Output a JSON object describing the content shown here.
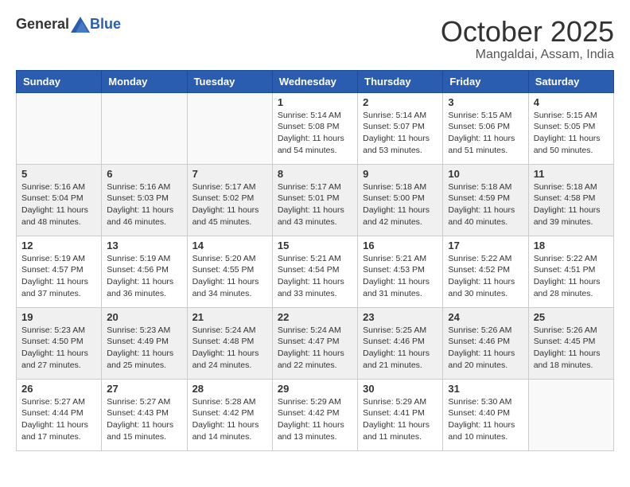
{
  "header": {
    "logo_general": "General",
    "logo_blue": "Blue",
    "month": "October 2025",
    "location": "Mangaldai, Assam, India"
  },
  "weekdays": [
    "Sunday",
    "Monday",
    "Tuesday",
    "Wednesday",
    "Thursday",
    "Friday",
    "Saturday"
  ],
  "weeks": [
    [
      {
        "day": "",
        "sunrise": "",
        "sunset": "",
        "daylight": ""
      },
      {
        "day": "",
        "sunrise": "",
        "sunset": "",
        "daylight": ""
      },
      {
        "day": "",
        "sunrise": "",
        "sunset": "",
        "daylight": ""
      },
      {
        "day": "1",
        "sunrise": "Sunrise: 5:14 AM",
        "sunset": "Sunset: 5:08 PM",
        "daylight": "Daylight: 11 hours and 54 minutes."
      },
      {
        "day": "2",
        "sunrise": "Sunrise: 5:14 AM",
        "sunset": "Sunset: 5:07 PM",
        "daylight": "Daylight: 11 hours and 53 minutes."
      },
      {
        "day": "3",
        "sunrise": "Sunrise: 5:15 AM",
        "sunset": "Sunset: 5:06 PM",
        "daylight": "Daylight: 11 hours and 51 minutes."
      },
      {
        "day": "4",
        "sunrise": "Sunrise: 5:15 AM",
        "sunset": "Sunset: 5:05 PM",
        "daylight": "Daylight: 11 hours and 50 minutes."
      }
    ],
    [
      {
        "day": "5",
        "sunrise": "Sunrise: 5:16 AM",
        "sunset": "Sunset: 5:04 PM",
        "daylight": "Daylight: 11 hours and 48 minutes."
      },
      {
        "day": "6",
        "sunrise": "Sunrise: 5:16 AM",
        "sunset": "Sunset: 5:03 PM",
        "daylight": "Daylight: 11 hours and 46 minutes."
      },
      {
        "day": "7",
        "sunrise": "Sunrise: 5:17 AM",
        "sunset": "Sunset: 5:02 PM",
        "daylight": "Daylight: 11 hours and 45 minutes."
      },
      {
        "day": "8",
        "sunrise": "Sunrise: 5:17 AM",
        "sunset": "Sunset: 5:01 PM",
        "daylight": "Daylight: 11 hours and 43 minutes."
      },
      {
        "day": "9",
        "sunrise": "Sunrise: 5:18 AM",
        "sunset": "Sunset: 5:00 PM",
        "daylight": "Daylight: 11 hours and 42 minutes."
      },
      {
        "day": "10",
        "sunrise": "Sunrise: 5:18 AM",
        "sunset": "Sunset: 4:59 PM",
        "daylight": "Daylight: 11 hours and 40 minutes."
      },
      {
        "day": "11",
        "sunrise": "Sunrise: 5:18 AM",
        "sunset": "Sunset: 4:58 PM",
        "daylight": "Daylight: 11 hours and 39 minutes."
      }
    ],
    [
      {
        "day": "12",
        "sunrise": "Sunrise: 5:19 AM",
        "sunset": "Sunset: 4:57 PM",
        "daylight": "Daylight: 11 hours and 37 minutes."
      },
      {
        "day": "13",
        "sunrise": "Sunrise: 5:19 AM",
        "sunset": "Sunset: 4:56 PM",
        "daylight": "Daylight: 11 hours and 36 minutes."
      },
      {
        "day": "14",
        "sunrise": "Sunrise: 5:20 AM",
        "sunset": "Sunset: 4:55 PM",
        "daylight": "Daylight: 11 hours and 34 minutes."
      },
      {
        "day": "15",
        "sunrise": "Sunrise: 5:21 AM",
        "sunset": "Sunset: 4:54 PM",
        "daylight": "Daylight: 11 hours and 33 minutes."
      },
      {
        "day": "16",
        "sunrise": "Sunrise: 5:21 AM",
        "sunset": "Sunset: 4:53 PM",
        "daylight": "Daylight: 11 hours and 31 minutes."
      },
      {
        "day": "17",
        "sunrise": "Sunrise: 5:22 AM",
        "sunset": "Sunset: 4:52 PM",
        "daylight": "Daylight: 11 hours and 30 minutes."
      },
      {
        "day": "18",
        "sunrise": "Sunrise: 5:22 AM",
        "sunset": "Sunset: 4:51 PM",
        "daylight": "Daylight: 11 hours and 28 minutes."
      }
    ],
    [
      {
        "day": "19",
        "sunrise": "Sunrise: 5:23 AM",
        "sunset": "Sunset: 4:50 PM",
        "daylight": "Daylight: 11 hours and 27 minutes."
      },
      {
        "day": "20",
        "sunrise": "Sunrise: 5:23 AM",
        "sunset": "Sunset: 4:49 PM",
        "daylight": "Daylight: 11 hours and 25 minutes."
      },
      {
        "day": "21",
        "sunrise": "Sunrise: 5:24 AM",
        "sunset": "Sunset: 4:48 PM",
        "daylight": "Daylight: 11 hours and 24 minutes."
      },
      {
        "day": "22",
        "sunrise": "Sunrise: 5:24 AM",
        "sunset": "Sunset: 4:47 PM",
        "daylight": "Daylight: 11 hours and 22 minutes."
      },
      {
        "day": "23",
        "sunrise": "Sunrise: 5:25 AM",
        "sunset": "Sunset: 4:46 PM",
        "daylight": "Daylight: 11 hours and 21 minutes."
      },
      {
        "day": "24",
        "sunrise": "Sunrise: 5:26 AM",
        "sunset": "Sunset: 4:46 PM",
        "daylight": "Daylight: 11 hours and 20 minutes."
      },
      {
        "day": "25",
        "sunrise": "Sunrise: 5:26 AM",
        "sunset": "Sunset: 4:45 PM",
        "daylight": "Daylight: 11 hours and 18 minutes."
      }
    ],
    [
      {
        "day": "26",
        "sunrise": "Sunrise: 5:27 AM",
        "sunset": "Sunset: 4:44 PM",
        "daylight": "Daylight: 11 hours and 17 minutes."
      },
      {
        "day": "27",
        "sunrise": "Sunrise: 5:27 AM",
        "sunset": "Sunset: 4:43 PM",
        "daylight": "Daylight: 11 hours and 15 minutes."
      },
      {
        "day": "28",
        "sunrise": "Sunrise: 5:28 AM",
        "sunset": "Sunset: 4:42 PM",
        "daylight": "Daylight: 11 hours and 14 minutes."
      },
      {
        "day": "29",
        "sunrise": "Sunrise: 5:29 AM",
        "sunset": "Sunset: 4:42 PM",
        "daylight": "Daylight: 11 hours and 13 minutes."
      },
      {
        "day": "30",
        "sunrise": "Sunrise: 5:29 AM",
        "sunset": "Sunset: 4:41 PM",
        "daylight": "Daylight: 11 hours and 11 minutes."
      },
      {
        "day": "31",
        "sunrise": "Sunrise: 5:30 AM",
        "sunset": "Sunset: 4:40 PM",
        "daylight": "Daylight: 11 hours and 10 minutes."
      },
      {
        "day": "",
        "sunrise": "",
        "sunset": "",
        "daylight": ""
      }
    ]
  ]
}
